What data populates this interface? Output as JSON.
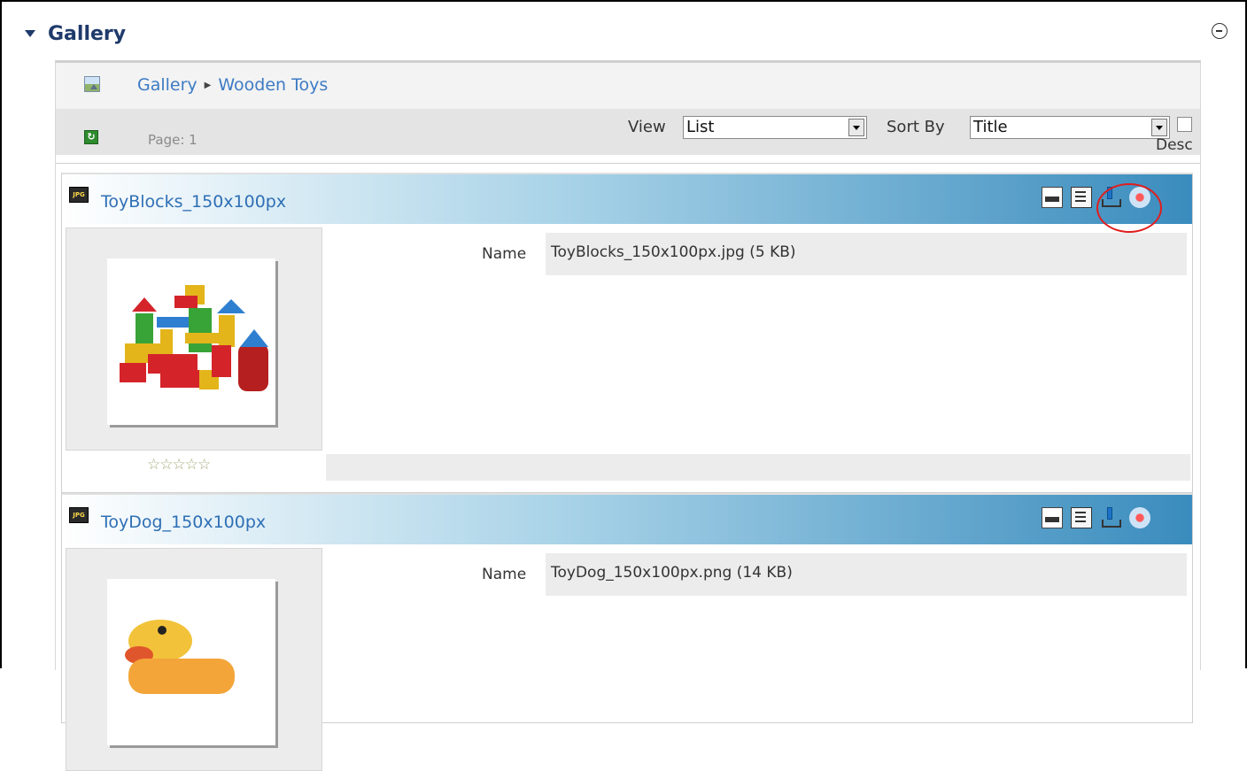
{
  "portlet": {
    "title": "Gallery"
  },
  "breadcrumb": {
    "items": [
      "Gallery",
      "Wooden Toys"
    ]
  },
  "toolbar": {
    "page_label": "Page: 1",
    "view_label": "View",
    "view_value": "List",
    "sort_label": "Sort By",
    "sort_value": "Title",
    "desc_label": "Desc"
  },
  "items": [
    {
      "title": "ToyBlocks_150x100px",
      "name_label": "Name",
      "name_value": "ToyBlocks_150x100px.jpg (5 KB)",
      "rating": "☆☆☆☆☆",
      "actions": [
        "resize-icon",
        "properties-icon",
        "download-icon",
        "workflow-icon"
      ]
    },
    {
      "title": "ToyDog_150x100px",
      "name_label": "Name",
      "name_value": "ToyDog_150x100px.png (14 KB)",
      "actions": [
        "resize-icon",
        "properties-icon",
        "download-icon",
        "workflow-icon"
      ]
    }
  ],
  "icons": {
    "file_type_badge": "JPG"
  },
  "colors": {
    "link": "#3d7bc4",
    "header_gradient_end": "#3a8cbe",
    "highlight_ring": "#e11d1d"
  }
}
